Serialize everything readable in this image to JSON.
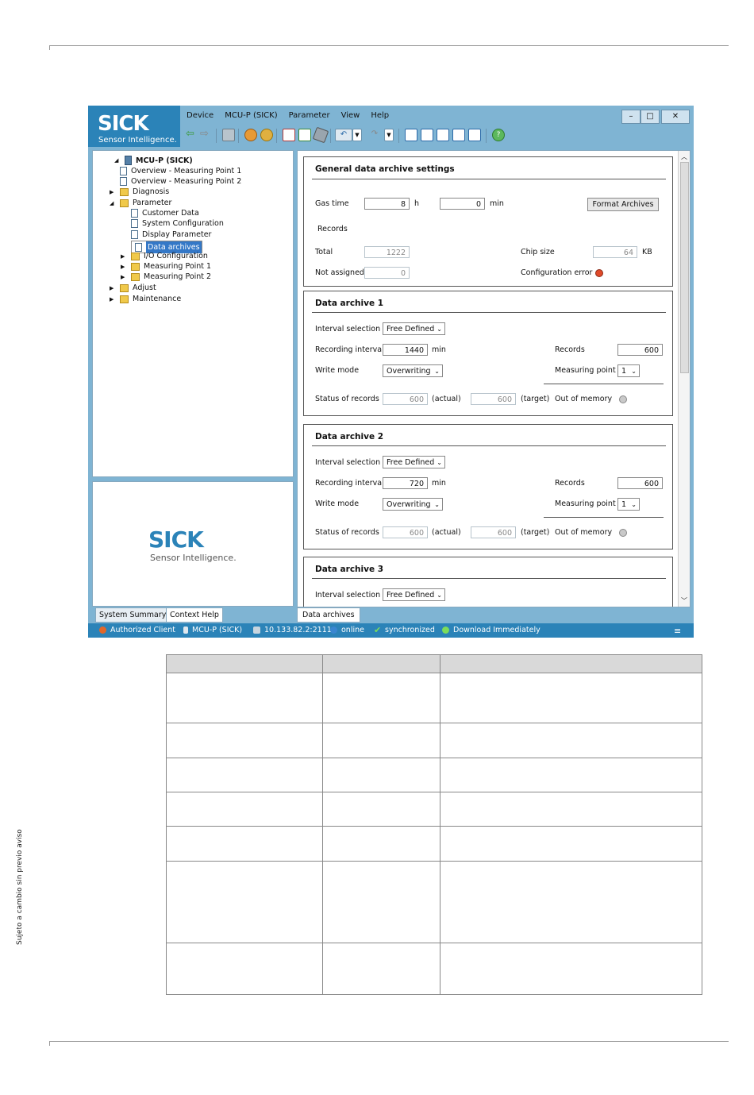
{
  "page": {
    "side_note": "Sujeto a cambio sin previo aviso"
  },
  "app": {
    "logo_text": "SICK",
    "logo_tagline": "Sensor Intelligence.",
    "menu": [
      "Device",
      "MCU-P (SICK)",
      "Parameter",
      "View",
      "Help"
    ],
    "window_buttons": {
      "minimize": "–",
      "maximize": "□",
      "close": "✕"
    }
  },
  "tree": {
    "items": [
      {
        "label": "MCU-P (SICK)",
        "icon": "device-icon",
        "bold": true
      },
      {
        "label": "Overview - Measuring Point 1",
        "icon": "document-icon"
      },
      {
        "label": "Overview - Measuring Point 2",
        "icon": "document-icon"
      },
      {
        "label": "Diagnosis",
        "icon": "folder-icon"
      },
      {
        "label": "Parameter",
        "icon": "folder-icon"
      },
      {
        "label": "Customer Data",
        "icon": "document-icon"
      },
      {
        "label": "System Configuration",
        "icon": "document-icon"
      },
      {
        "label": "Display Parameter",
        "icon": "document-icon"
      },
      {
        "label": "Data archives",
        "icon": "document-icon",
        "selected": true
      },
      {
        "label": "I/O Configuration",
        "icon": "folder-icon"
      },
      {
        "label": "Measuring Point 1",
        "icon": "folder-icon"
      },
      {
        "label": "Measuring Point 2",
        "icon": "folder-icon"
      },
      {
        "label": "Adjust",
        "icon": "folder-icon"
      },
      {
        "label": "Maintenance",
        "icon": "folder-icon"
      }
    ]
  },
  "help_panel": {
    "logo_text": "SICK",
    "logo_tagline": "Sensor Intelligence."
  },
  "bottom_tabs": [
    "System Summary",
    "Context Help"
  ],
  "content_tab": "Data archives",
  "general": {
    "title": "General data archive settings",
    "gas_time_label": "Gas time",
    "gas_time_h": "8",
    "h_unit": "h",
    "gas_time_min": "0",
    "min_unit": "min",
    "format_button": "Format Archives",
    "records_label": "Records",
    "total_label": "Total",
    "total_value": "1222",
    "chip_size_label": "Chip size",
    "chip_size_value": "64",
    "kb_unit": "KB",
    "not_assigned_label": "Not assigned",
    "not_assigned_value": "0",
    "config_error_label": "Configuration error",
    "config_error_color": "#e04a2a"
  },
  "archives": [
    {
      "title": "Data archive 1",
      "interval_selection_label": "Interval selection",
      "interval_selection": "Free Defined",
      "recording_interval_label": "Recording interval",
      "recording_interval": "1440",
      "min_unit": "min",
      "records_label": "Records",
      "records": "600",
      "write_mode_label": "Write mode",
      "write_mode": "Overwriting",
      "measuring_point_label": "Measuring point",
      "measuring_point": "1",
      "status_label": "Status of records",
      "actual": "600",
      "actual_label": "(actual)",
      "target": "600",
      "target_label": "(target)",
      "out_of_memory_label": "Out of memory"
    },
    {
      "title": "Data archive 2",
      "interval_selection_label": "Interval selection",
      "interval_selection": "Free Defined",
      "recording_interval_label": "Recording interval",
      "recording_interval": "720",
      "min_unit": "min",
      "records_label": "Records",
      "records": "600",
      "write_mode_label": "Write mode",
      "write_mode": "Overwriting",
      "measuring_point_label": "Measuring point",
      "measuring_point": "1",
      "status_label": "Status of records",
      "actual": "600",
      "actual_label": "(actual)",
      "target": "600",
      "target_label": "(target)",
      "out_of_memory_label": "Out of memory"
    },
    {
      "title": "Data archive 3",
      "interval_selection_label": "Interval selection",
      "interval_selection": "Free Defined"
    }
  ],
  "status_bar": {
    "user": "Authorized Client",
    "device": "MCU-P (SICK)",
    "address": "10.133.82.2:2111",
    "online": "online",
    "sync": "synchronized",
    "download": "Download Immediately"
  }
}
